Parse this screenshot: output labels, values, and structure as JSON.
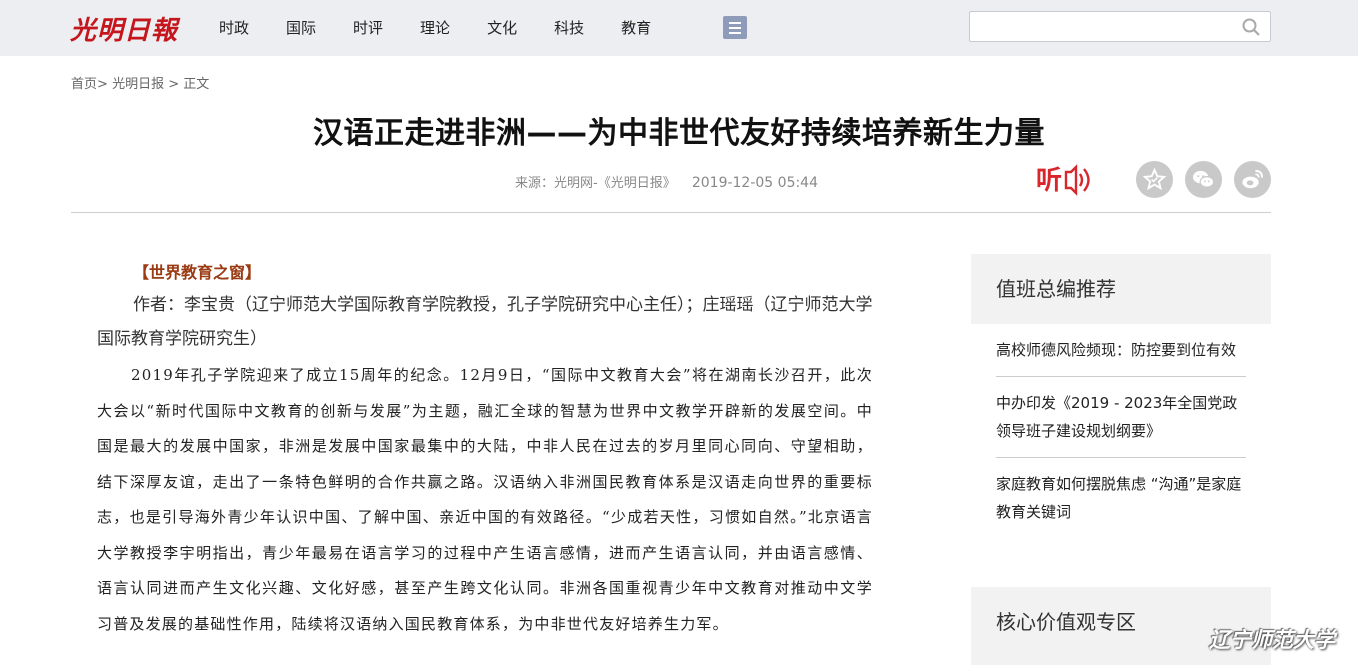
{
  "header": {
    "logo": "光明日報",
    "nav": [
      "时政",
      "国际",
      "时评",
      "理论",
      "文化",
      "科技",
      "教育"
    ],
    "search_placeholder": ""
  },
  "breadcrumb": {
    "home": "首页",
    "sep1": ">",
    "section": "光明日报",
    "sep2": ">",
    "current": "正文"
  },
  "article": {
    "title": "汉语正走进非洲——为中非世代友好持续培养新生力量",
    "source": "来源：光明网-《光明日报》",
    "date": "2019-12-05 05:44",
    "listen_label": "听",
    "column_tag": "【世界教育之窗】",
    "author": "作者：李宝贵（辽宁师范大学国际教育学院教授，孔子学院研究中心主任）；庄瑶瑶（辽宁师范大学国际教育学院研究生）",
    "body": "2019年孔子学院迎来了成立15周年的纪念。12月9日，“国际中文教育大会”将在湖南长沙召开，此次大会以“新时代国际中文教育的创新与发展”为主题，融汇全球的智慧为世界中文教学开辟新的发展空间。中国是最大的发展中国家，非洲是发展中国家最集中的大陆，中非人民在过去的岁月里同心同向、守望相助，结下深厚友谊，走出了一条特色鲜明的合作共赢之路。汉语纳入非洲国民教育体系是汉语走向世界的重要标志，也是引导海外青少年认识中国、了解中国、亲近中国的有效路径。“少成若天性，习惯如自然。”北京语言大学教授李宇明指出，青少年最易在语言学习的过程中产生语言感情，进而产生语言认同，并由语言感情、语言认同进而产生文化兴趣、文化好感，甚至产生跨文化认同。非洲各国重视青少年中文教育对推动中文学习普及发展的基础性作用，陆续将汉语纳入国民教育体系，为中非世代友好培养生力军。"
  },
  "sidebar": {
    "recommend_title": "值班总编推荐",
    "items": [
      "高校师德风险频现：防控要到位有效",
      "中办印发《2019 - 2023年全国党政领导班子建设规划纲要》",
      "家庭教育如何摆脱焦虑 “沟通”是家庭教育关键词"
    ],
    "core_title": "核心价值观专区"
  },
  "watermark": "辽宁师范大学",
  "colors": {
    "brand_red": "#c4161c",
    "column_tag": "#9b3b13",
    "topbar_bg": "#eceef1",
    "share_gray": "#c9c9c9"
  }
}
